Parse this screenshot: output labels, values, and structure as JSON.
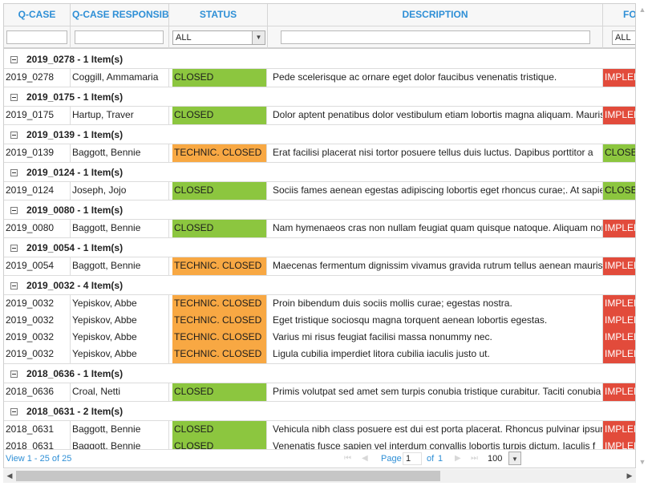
{
  "columns": [
    "Q-CASE",
    "Q-CASE RESPONSIBLE",
    "STATUS",
    "DESCRIPTION",
    "FOLLOW-UP"
  ],
  "filters": {
    "status_value": "ALL",
    "followup_value": "ALL"
  },
  "groups": [
    {
      "label": "2019_0278 - 1 Item(s)",
      "rows": [
        {
          "qcase": "2019_0278",
          "resp": "Coggill, Ammamaria",
          "status": "CLOSED",
          "desc": "Pede scelerisque ac ornare eget dolor faucibus venenatis tristique.",
          "followup": "IMPLEMENTED"
        }
      ]
    },
    {
      "label": "2019_0175 - 1 Item(s)",
      "rows": [
        {
          "qcase": "2019_0175",
          "resp": "Hartup, Traver",
          "status": "CLOSED",
          "desc": "Dolor aptent penatibus dolor vestibulum etiam lobortis magna aliquam. Mauris",
          "followup": "IMPLEMENTED"
        }
      ]
    },
    {
      "label": "2019_0139 - 1 Item(s)",
      "rows": [
        {
          "qcase": "2019_0139",
          "resp": "Baggott, Bennie",
          "status": "TECHNIC. CLOSED",
          "desc": "Erat facilisi placerat nisi tortor posuere tellus duis luctus. Dapibus porttitor a",
          "followup": "CLOSED"
        }
      ]
    },
    {
      "label": "2019_0124 - 1 Item(s)",
      "rows": [
        {
          "qcase": "2019_0124",
          "resp": "Joseph, Jojo",
          "status": "CLOSED",
          "desc": "Sociis fames aenean egestas adipiscing lobortis eget rhoncus curae;. At sapien",
          "followup": "CLOSED"
        }
      ]
    },
    {
      "label": "2019_0080 - 1 Item(s)",
      "rows": [
        {
          "qcase": "2019_0080",
          "resp": "Baggott, Bennie",
          "status": "CLOSED",
          "desc": "Nam hymenaeos cras non nullam feugiat quam quisque natoque. Aliquam non",
          "followup": "IMPLEMENTED"
        }
      ]
    },
    {
      "label": "2019_0054 - 1 Item(s)",
      "rows": [
        {
          "qcase": "2019_0054",
          "resp": "Baggott, Bennie",
          "status": "TECHNIC. CLOSED",
          "desc": "Maecenas fermentum dignissim vivamus gravida rutrum tellus aenean mauris",
          "followup": "IMPLEMENTED"
        }
      ]
    },
    {
      "label": "2019_0032 - 4 Item(s)",
      "rows": [
        {
          "qcase": "2019_0032",
          "resp": "Yepiskov, Abbe",
          "status": "TECHNIC. CLOSED",
          "desc": "Proin bibendum duis sociis mollis curae; egestas nostra.",
          "followup": "IMPLEMENTED"
        },
        {
          "qcase": "2019_0032",
          "resp": "Yepiskov, Abbe",
          "status": "TECHNIC. CLOSED",
          "desc": "Eget tristique sociosqu magna torquent aenean lobortis egestas.",
          "followup": "IMPLEMENTED"
        },
        {
          "qcase": "2019_0032",
          "resp": "Yepiskov, Abbe",
          "status": "TECHNIC. CLOSED",
          "desc": "Varius mi risus feugiat facilisi massa nonummy nec.",
          "followup": "IMPLEMENTED"
        },
        {
          "qcase": "2019_0032",
          "resp": "Yepiskov, Abbe",
          "status": "TECHNIC. CLOSED",
          "desc": "Ligula cubilia imperdiet litora cubilia iaculis justo ut.",
          "followup": "IMPLEMENTED"
        }
      ]
    },
    {
      "label": "2018_0636 - 1 Item(s)",
      "rows": [
        {
          "qcase": "2018_0636",
          "resp": "Croal, Netti",
          "status": "CLOSED",
          "desc": "Primis volutpat sed amet sem turpis conubia tristique curabitur. Taciti conubia",
          "followup": "IMPLEMENTED"
        }
      ]
    },
    {
      "label": "2018_0631 - 2 Item(s)",
      "rows": [
        {
          "qcase": "2018_0631",
          "resp": "Baggott, Bennie",
          "status": "CLOSED",
          "desc": "Vehicula nibh class posuere est dui est porta placerat. Rhoncus pulvinar ipsum",
          "followup": "IMPLEMENTED"
        },
        {
          "qcase": "2018_0631",
          "resp": "Baggott, Bennie",
          "status": "CLOSED",
          "desc": "Venenatis fusce sapien vel interdum convallis lobortis turpis dictum. Iaculis f",
          "followup": "IMPLEMENTED"
        }
      ]
    }
  ],
  "pager": {
    "view_info": "View 1 - 25 of 25",
    "page_label": "Page",
    "page_value": "1",
    "of_label": "of",
    "page_count": "1",
    "rows_per_page": "100",
    "first_icon": "first-page-icon",
    "prev_icon": "prev-page-icon",
    "next_icon": "next-page-icon",
    "last_icon": "last-page-icon"
  },
  "colors": {
    "header_text": "#2e8fd6",
    "closed": "#8cc63f",
    "technic_closed": "#f8a843",
    "implemented": "#e24b3b"
  }
}
